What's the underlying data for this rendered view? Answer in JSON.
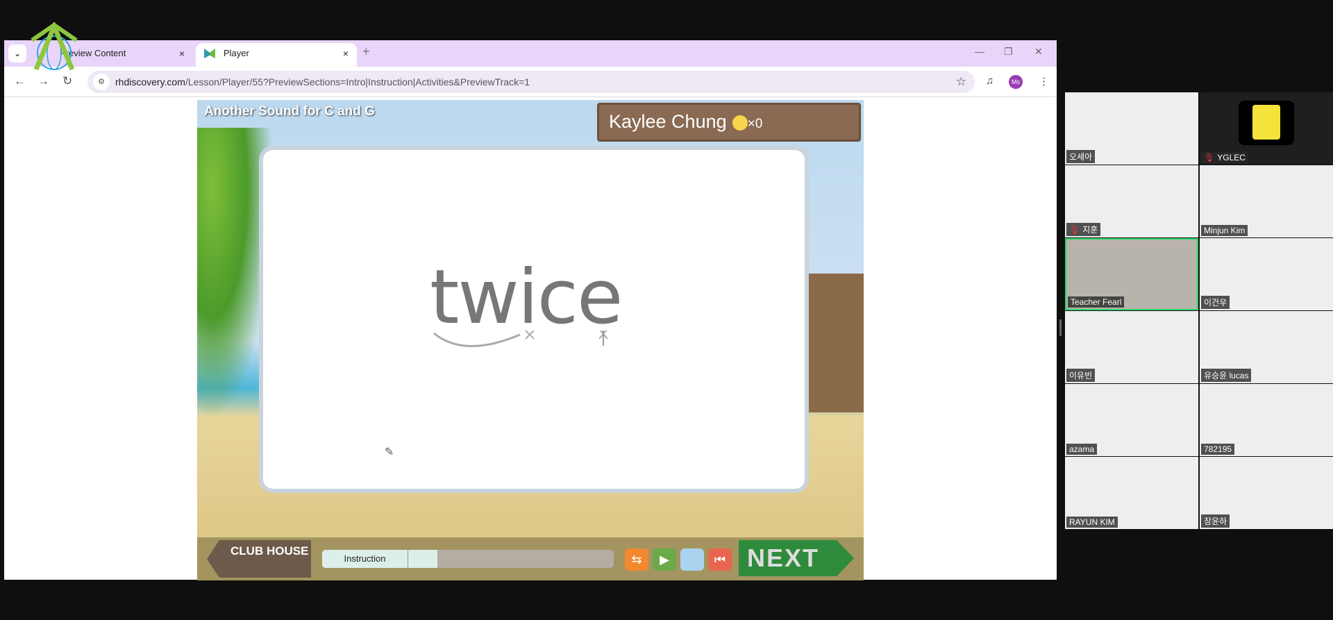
{
  "browser": {
    "tabs": [
      {
        "label": "Preview Content",
        "close": "×"
      },
      {
        "label": "Player",
        "close": "×"
      }
    ],
    "new_tab": "+",
    "url_host": "rhdiscovery.com",
    "url_path": "/Lesson/Player/55?PreviewSections=Intro|Instruction|Activities&PreviewTrack=1",
    "profile": "Ms"
  },
  "game": {
    "title": "Another Sound for C and G",
    "student": "Kaylee Chung",
    "coins": "×0",
    "word": "twice",
    "club": "CLUB HOUSE",
    "section": "Instruction",
    "progress_percent": 10,
    "next": "NEXT"
  },
  "participants": [
    {
      "name": "오세아",
      "muted": false
    },
    {
      "name": "YGLEC",
      "muted": true
    },
    {
      "name": "지훈",
      "muted": true
    },
    {
      "name": "Minjun Kim",
      "muted": false
    },
    {
      "name": "Teacher Fearl",
      "muted": false,
      "active": true
    },
    {
      "name": "이건우",
      "muted": false
    },
    {
      "name": "이유빈",
      "muted": false
    },
    {
      "name": "유승윤 lucas",
      "muted": false
    },
    {
      "name": "azama",
      "muted": false
    },
    {
      "name": "782195",
      "muted": false
    },
    {
      "name": "RAYUN KIM",
      "muted": false
    },
    {
      "name": "장윤하",
      "muted": false
    }
  ],
  "colors": {
    "tab_bar": "#e8d5f9",
    "active_speaker": "#2bd46a",
    "next_button": "#2e8b3c"
  }
}
